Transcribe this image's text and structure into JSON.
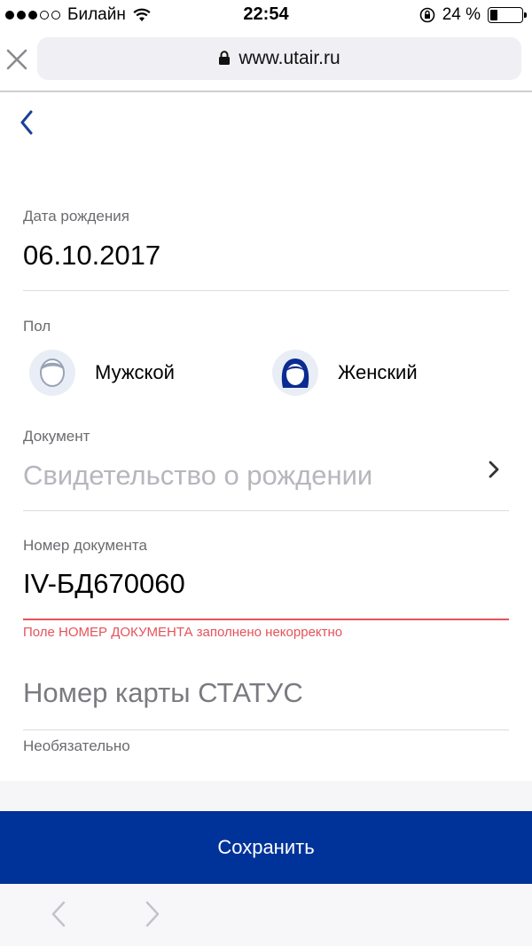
{
  "status_bar": {
    "carrier": "Билайн",
    "time": "22:54",
    "battery_text": "24 %",
    "battery_level": 0.24
  },
  "browser": {
    "url": "www.utair.ru"
  },
  "form": {
    "birth_date": {
      "label": "Дата рождения",
      "value": "06.10.2017"
    },
    "gender": {
      "label": "Пол",
      "male": "Мужской",
      "female": "Женский"
    },
    "document": {
      "label": "Документ",
      "value": "Свидетельство о рождении"
    },
    "document_number": {
      "label": "Номер документа",
      "value": "IV-БД670060",
      "error": "Поле НОМЕР ДОКУМЕНТА заполнено некорректно"
    },
    "status_card": {
      "placeholder": "Номер карты СТАТУС",
      "hint": "Необязательно"
    }
  },
  "actions": {
    "save_label": "Сохранить"
  },
  "colors": {
    "primary": "#003399",
    "error": "#e5525a",
    "link": "#1a3f9c"
  },
  "icons": [
    "close-icon",
    "lock-icon",
    "back-chevron-icon",
    "male-avatar-icon",
    "female-avatar-icon",
    "chevron-right-icon",
    "browser-back-icon",
    "browser-forward-icon"
  ]
}
